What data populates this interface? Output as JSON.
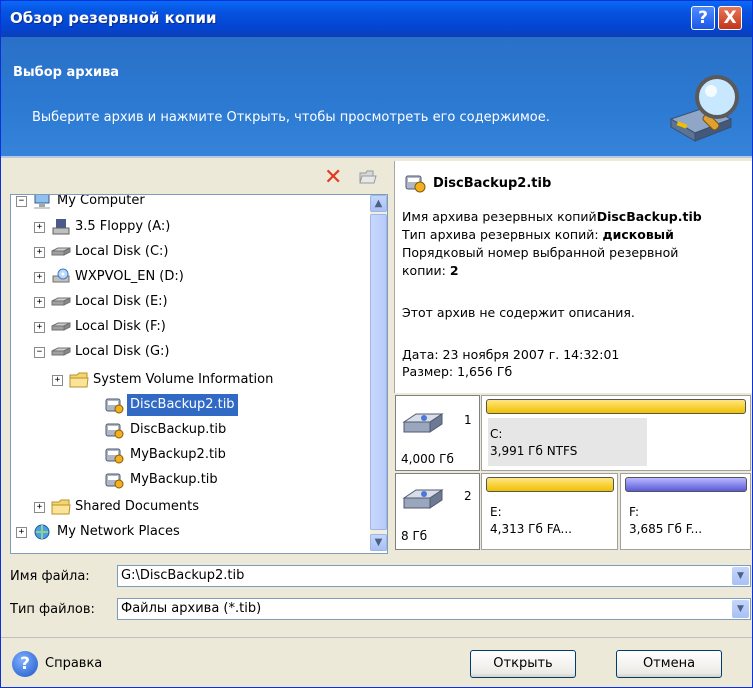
{
  "window": {
    "title": "Обзор резервной копии",
    "help_button": "?",
    "close_button": "X"
  },
  "header": {
    "title": "Выбор архива",
    "subtitle": "Выберите архив и нажмите Открыть, чтобы просмотреть его содержимое."
  },
  "toolbar": {
    "delete_icon": "delete-icon",
    "new_folder_icon": "folder-icon"
  },
  "tree": {
    "items": [
      {
        "label": "My Computer",
        "icon": "computer-icon",
        "expander": "−"
      },
      {
        "label": "3.5 Floppy (A:)",
        "icon": "floppy-icon",
        "expander": "+"
      },
      {
        "label": "Local Disk (C:)",
        "icon": "hard-disk-icon",
        "expander": "+"
      },
      {
        "label": "WXPVOL_EN (D:)",
        "icon": "cd-drive-icon",
        "expander": "+"
      },
      {
        "label": "Local Disk (E:)",
        "icon": "hard-disk-icon",
        "expander": "+"
      },
      {
        "label": "Local Disk (F:)",
        "icon": "hard-disk-icon",
        "expander": "+"
      },
      {
        "label": "Local Disk (G:)",
        "icon": "hard-disk-icon",
        "expander": "−"
      },
      {
        "label": "System Volume Information",
        "icon": "folder-icon",
        "expander": "+"
      },
      {
        "label": "DiscBackup2.tib",
        "icon": "archive-icon",
        "selected": true
      },
      {
        "label": "DiscBackup.tib",
        "icon": "archive-icon"
      },
      {
        "label": "MyBackup2.tib",
        "icon": "archive-icon"
      },
      {
        "label": "MyBackup.tib",
        "icon": "archive-icon"
      },
      {
        "label": "Shared Documents",
        "icon": "folder-icon",
        "expander": "+"
      },
      {
        "label": "My Network Places",
        "icon": "network-icon",
        "expander": "+"
      }
    ]
  },
  "info": {
    "filename": "DiscBackup2.tib",
    "name_label": "Имя архива резервных копий",
    "name_value": "DiscBackup.tib",
    "type_label": "Тип архива резервных копий: ",
    "type_value": "дисковый",
    "seq_label_1": "Порядковый номер выбранной резервной",
    "seq_label_2": "копии: ",
    "seq_value": "2",
    "no_description": "Этот архив не содержит описания.",
    "date": "Дата: 23 ноября 2007 г. 14:32:01",
    "size": "Размер: 1,656 Гб"
  },
  "disks": [
    {
      "number": "1",
      "size": "4,000 Гб",
      "partitions": [
        {
          "letter": "C:",
          "detail": "3,991 Гб  NTFS",
          "color": "#f0c000",
          "used_fraction": 0.65
        }
      ]
    },
    {
      "number": "2",
      "size": "8 Гб",
      "partitions": [
        {
          "letter": "E:",
          "detail": "4,313 Гб  FA...",
          "color": "#f0c000"
        },
        {
          "letter": "F:",
          "detail": "3,685 Гб  F...",
          "color": "#5a5ad8"
        }
      ]
    }
  ],
  "fields": {
    "filename_label": "Имя файла:",
    "filename_value": "G:\\DiscBackup2.tib",
    "filetype_label": "Тип файлов:",
    "filetype_value": "Файлы архива (*.tib)"
  },
  "footer": {
    "help_label": "Справка",
    "open_button": "Открыть",
    "cancel_button": "Отмена"
  }
}
